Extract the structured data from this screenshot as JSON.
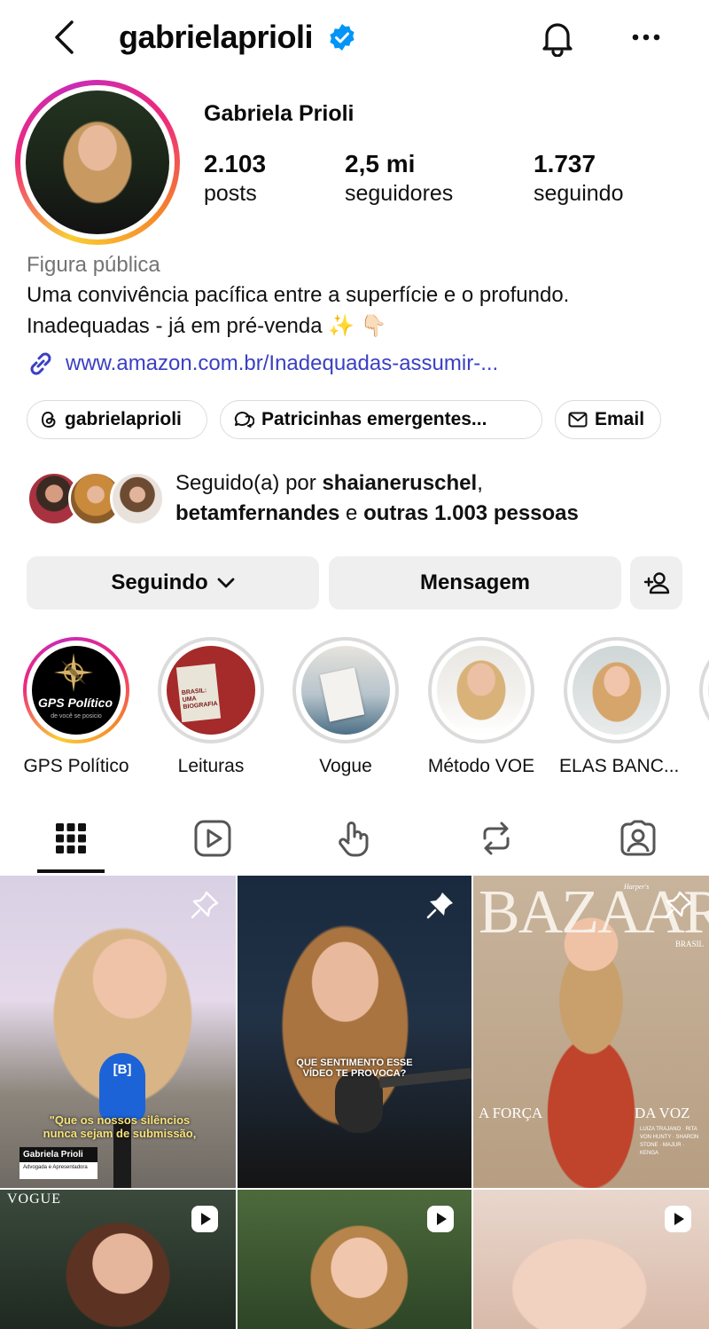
{
  "header": {
    "username": "gabrielaprioli",
    "verified": true
  },
  "profile": {
    "display_name": "Gabriela Prioli",
    "stats": [
      {
        "value": "2.103",
        "label": "posts"
      },
      {
        "value": "2,5 mi",
        "label": "seguidores"
      },
      {
        "value": "1.737",
        "label": "seguindo"
      }
    ],
    "category": "Figura pública",
    "bio_line1": "Uma convivência pacífica entre a superfície e o profundo.",
    "bio_line2": "Inadequadas - já em pré-venda ✨ 👇🏻",
    "link": "www.amazon.com.br/Inadequadas-assumir-..."
  },
  "chips": {
    "threads": "gabrielaprioli",
    "channel": "Patricinhas emergentes...",
    "email": "Email"
  },
  "followed_by": {
    "prefix": "Seguido(a) por ",
    "user1": "shaianeruschel",
    "comma": ",",
    "user2": "betamfernandes",
    "conj": " e ",
    "others": "outras 1.003 pessoas"
  },
  "actions": {
    "following": "Seguindo",
    "message": "Mensagem"
  },
  "highlights": [
    {
      "label": "GPS Político",
      "cover_title": "GPS Político",
      "cover_sub": "de você se posicio"
    },
    {
      "label": "Leituras",
      "cover_title": "BRASIL: UMA BIOGRAFIA"
    },
    {
      "label": "Vogue"
    },
    {
      "label": "Método VOE"
    },
    {
      "label": "ELAS BANC..."
    }
  ],
  "grid": {
    "post1": {
      "quote": "\"Que os nossos silêncios nunca sejam de submissão,",
      "name": "Gabriela Prioli",
      "role": "Advogada e Apresentadora",
      "mic": "[B]"
    },
    "post2": {
      "caption": "QUE SENTIMENTO ESSE VÍDEO TE PROVOCA?"
    },
    "post3": {
      "kicker": "Harper's",
      "masthead": "BAZAAR",
      "edition": "BRASIL",
      "left": "A FORÇA",
      "right": "DA VOZ",
      "names": "LUIZA TRAJANO · RITA VON HUNTY · SHARON STONE · MAJUR · KENGA"
    },
    "post4": {
      "masthead": "VOGUE"
    }
  },
  "colors": {
    "link": "#3a3fc4",
    "button_bg": "#efefef",
    "muted_text": "#737373",
    "verified_blue": "#0095f6"
  }
}
